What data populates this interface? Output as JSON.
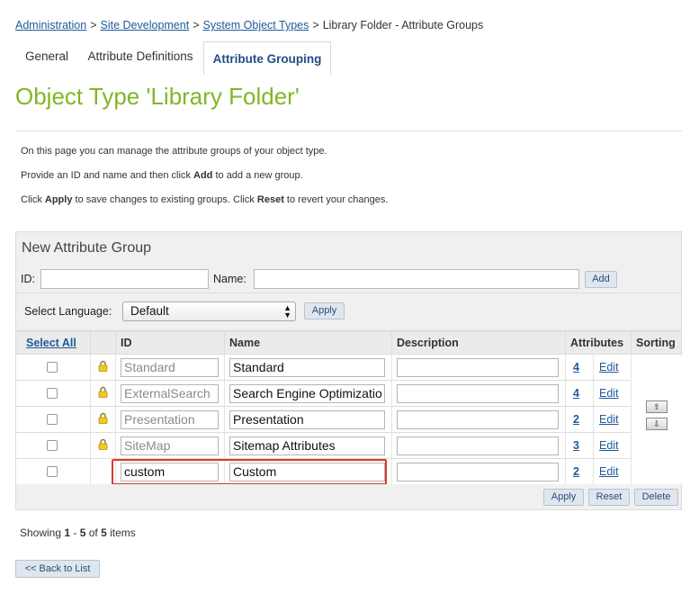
{
  "breadcrumb": {
    "items": [
      "Administration",
      "Site Development",
      "System Object Types"
    ],
    "separator": ">",
    "current": "Library Folder - Attribute Groups"
  },
  "tabs": [
    {
      "label": "General",
      "active": false
    },
    {
      "label": "Attribute Definitions",
      "active": false
    },
    {
      "label": "Attribute Grouping",
      "active": true
    }
  ],
  "page_title": "Object Type 'Library Folder'",
  "intro": {
    "line1": "On this page you can manage the attribute groups of your object type.",
    "line2_pre": "Provide an ID and name and then click ",
    "line2_bold": "Add",
    "line2_post": " to add a new group.",
    "line3_pre": "Click ",
    "line3_bold1": "Apply",
    "line3_mid": " to save changes to existing groups. Click ",
    "line3_bold2": "Reset",
    "line3_post": " to revert your changes."
  },
  "new_group": {
    "title": "New Attribute Group",
    "id_label": "ID:",
    "id_value": "",
    "name_label": "Name:",
    "name_value": "",
    "add_label": "Add"
  },
  "language": {
    "label": "Select Language:",
    "selected": "Default",
    "apply_label": "Apply"
  },
  "grid": {
    "headers": {
      "select_all": "Select All",
      "id": "ID",
      "name": "Name",
      "description": "Description",
      "attributes": "Attributes",
      "sorting": "Sorting"
    },
    "rows": [
      {
        "id": "Standard",
        "name": "Standard",
        "description": "",
        "attributes": "4",
        "edit": "Edit",
        "locked": true
      },
      {
        "id": "ExternalSearch",
        "name": "Search Engine Optimizatio",
        "description": "",
        "attributes": "4",
        "edit": "Edit",
        "locked": true
      },
      {
        "id": "Presentation",
        "name": "Presentation",
        "description": "",
        "attributes": "2",
        "edit": "Edit",
        "locked": true
      },
      {
        "id": "SiteMap",
        "name": "Sitemap Attributes",
        "description": "",
        "attributes": "3",
        "edit": "Edit",
        "locked": true
      },
      {
        "id": "custom",
        "name": "Custom",
        "description": "",
        "attributes": "2",
        "edit": "Edit",
        "locked": false
      }
    ],
    "sort_up": "⇧",
    "sort_down": "⇩"
  },
  "actions": {
    "apply": "Apply",
    "reset": "Reset",
    "delete": "Delete"
  },
  "paging": {
    "prefix": "Showing ",
    "from": "1",
    "dash": " - ",
    "to": "5",
    "of": " of ",
    "total": "5",
    "suffix": " items"
  },
  "back_label": "<< Back to List",
  "colors": {
    "title_green": "#82b626",
    "link_blue": "#1f5a9a",
    "highlight_red": "#d83a2a"
  }
}
